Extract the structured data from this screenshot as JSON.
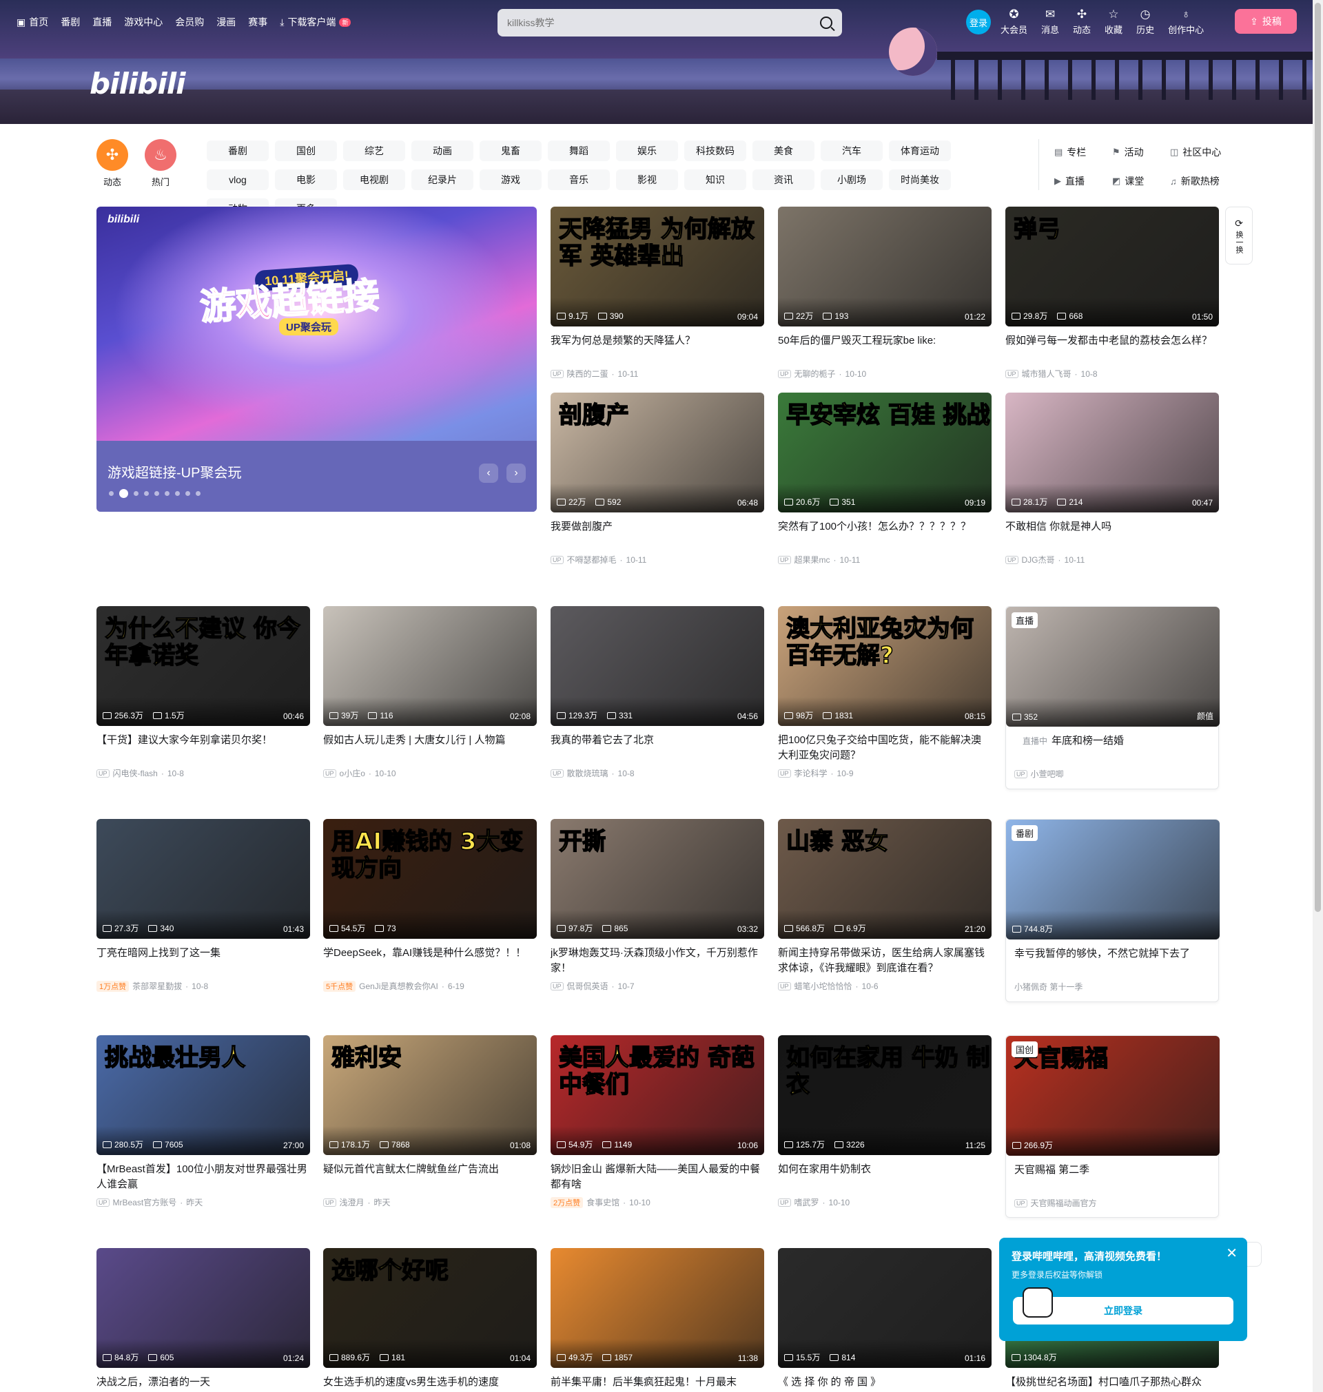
{
  "topnav": {
    "items": [
      "首页",
      "番剧",
      "直播",
      "游戏中心",
      "会员购",
      "漫画",
      "赛事",
      "下载客户端"
    ],
    "new_tag": "新"
  },
  "search": {
    "placeholder": "killkiss教学"
  },
  "header_right": {
    "login": "登录",
    "items": [
      "大会员",
      "消息",
      "动态",
      "收藏",
      "历史",
      "创作中心"
    ],
    "upload": "投稿"
  },
  "brand": {
    "logo_text": "bilibili"
  },
  "channels": {
    "big": [
      {
        "label": "动态",
        "color": "#ff8b27"
      },
      {
        "label": "热门",
        "color": "#f06e6e"
      }
    ],
    "grid": [
      "番剧",
      "国创",
      "综艺",
      "动画",
      "鬼畜",
      "舞蹈",
      "娱乐",
      "科技数码",
      "美食",
      "汽车",
      "体育运动",
      "vlog",
      "电影",
      "电视剧",
      "纪录片",
      "游戏",
      "音乐",
      "影视",
      "知识",
      "资讯",
      "小剧场",
      "时尚美妆",
      "动物",
      "更多"
    ],
    "right": [
      "专栏",
      "活动",
      "社区中心",
      "直播",
      "课堂",
      "新歌热榜"
    ]
  },
  "carousel": {
    "logo": "bilibili",
    "badge": "10.11聚会开启!",
    "headline": "游戏超链接",
    "sub": "UP聚会玩",
    "caption": "游戏超链接-UP聚会玩",
    "active_dot": 1,
    "dot_count": 9
  },
  "refresh": {
    "label": "换一换"
  },
  "colors": {
    "brand_pink": "#fb7299",
    "brand_blue": "#00aeec"
  },
  "videos": [
    {
      "thumb_text": "天降猛男 为何解放军 英雄辈出",
      "views": "9.1万",
      "danmaku": "390",
      "duration": "09:04",
      "title": "我军为何总是频繁的天降猛人？",
      "author": "陕西的二蛋",
      "date": "10-11",
      "bg": "#6b5a3a"
    },
    {
      "thumb_text": "",
      "views": "22万",
      "danmaku": "193",
      "duration": "01:22",
      "title": "50年后的僵尸毁灭工程玩家be like:",
      "author": "无聊的栀子",
      "date": "10-10",
      "bg": "#7d7468"
    },
    {
      "thumb_text": "弹弓",
      "views": "29.8万",
      "danmaku": "668",
      "duration": "01:50",
      "title": "假如弹弓每一发都击中老鼠的荔枝会怎么样？",
      "author": "城市猎人飞哥",
      "date": "10-8",
      "bg": "#2b2a24"
    },
    {
      "thumb_text": "剖腹产",
      "views": "22万",
      "danmaku": "592",
      "duration": "06:48",
      "title": "我要做剖腹产",
      "author": "不嘚瑟都掉毛",
      "date": "10-11",
      "bg": "#c9b7a3"
    },
    {
      "thumb_text": "早安宰炫 百娃 挑战",
      "views": "20.6万",
      "danmaku": "351",
      "duration": "09:19",
      "title": "突然有了100个小孩！怎么办？？？？？？",
      "author": "超果果mc",
      "date": "10-11",
      "bg": "#3a7a3a"
    },
    {
      "thumb_text": "",
      "views": "28.1万",
      "danmaku": "214",
      "duration": "00:47",
      "title": "不敢相信 你就是神人吗",
      "author": "DJG杰哥",
      "date": "10-11",
      "bg": "#d8b6c4"
    },
    {
      "thumb_text": "为什么不建议 你今年拿诺奖",
      "views": "256.3万",
      "danmaku": "1.5万",
      "duration": "00:46",
      "title": "【干货】建议大家今年别拿诺贝尔奖！",
      "author": "闪电侠-flash",
      "date": "10-8",
      "bg": "#2d2d2d"
    },
    {
      "thumb_text": "",
      "views": "39万",
      "danmaku": "116",
      "duration": "02:08",
      "title": "假如古人玩儿走秀 | 大唐女儿行 | 人物篇",
      "author": "o小庄o",
      "date": "10-10",
      "bg": "#c8c2ba"
    },
    {
      "thumb_text": "",
      "views": "129.3万",
      "danmaku": "331",
      "duration": "04:56",
      "title": "我真的带着它去了北京",
      "author": "散散烧琉璃",
      "date": "10-8",
      "bg": "#5c5a5e"
    },
    {
      "thumb_text": "澳大利亚兔灾为何 百年无解?",
      "views": "98万",
      "danmaku": "1831",
      "duration": "08:15",
      "title": "把100亿只兔子交给中国吃货，能不能解决澳大利亚兔灾问题？",
      "author": "李论科学",
      "date": "10-9",
      "bg": "#c9a27a"
    },
    {
      "thumb_text": "",
      "views": "352",
      "danmaku": "",
      "duration": "颜值",
      "title": "年底和榜一结婚",
      "author": "小萱吧唧",
      "date": "",
      "bg": "#bfb6b0",
      "tag": "直播",
      "live": "直播中"
    },
    {
      "thumb_text": "",
      "views": "27.3万",
      "danmaku": "340",
      "duration": "01:43",
      "title": "丁亮在暗网上找到了这一集",
      "author": "茶部翠星勤拔",
      "date": "10-8",
      "hot": "1万点赞",
      "bg": "#3d4a5a"
    },
    {
      "thumb_text": "用AI赚钱的 3大变现方向",
      "views": "54.5万",
      "danmaku": "73",
      "duration": "",
      "title": "学DeepSeek，靠AI赚钱是种什么感觉？！！",
      "author": "GenJi是真想教会你AI",
      "date": "6-19",
      "hot": "5千点赞",
      "bg": "#3a1f10"
    },
    {
      "thumb_text": "开撕",
      "views": "97.8万",
      "danmaku": "865",
      "duration": "03:32",
      "title": "jk罗琳炮轰艾玛·沃森顶级小作文，千万别惹作家！",
      "author": "侃哥侃英语",
      "date": "10-7",
      "bg": "#8a7a6e"
    },
    {
      "thumb_text": "山寨 恶女",
      "views": "566.8万",
      "danmaku": "6.9万",
      "duration": "21:20",
      "title": "新闻主持穿吊带做采访，医生给病人家属塞钱求体谅，《许我耀眼》到底谁在看？",
      "author": "蜡笔小坨恰恰恰",
      "date": "10-6",
      "bg": "#6e5a4a"
    },
    {
      "thumb_text": "",
      "views": "744.8万",
      "danmaku": "",
      "duration": "",
      "title": "幸亏我暂停的够快，不然它就掉下去了",
      "author": "小猪佩奇 第十一季",
      "date": "",
      "bg": "#8fb5e8",
      "tag": "番剧"
    },
    {
      "thumb_text": "挑战最壮男人",
      "views": "280.5万",
      "danmaku": "7605",
      "duration": "27:00",
      "title": "【MrBeast首发】100位小朋友对世界最强壮男人谁会赢",
      "author": "MrBeast官方账号",
      "date": "昨天",
      "bg": "#4a6aa8"
    },
    {
      "thumb_text": "雅利安",
      "views": "178.1万",
      "danmaku": "7868",
      "duration": "01:08",
      "title": "疑似元首代言鱿太仁牌鱿鱼丝广告流出",
      "author": "浅澄月",
      "date": "昨天",
      "bg": "#c9a87a"
    },
    {
      "thumb_text": "美国人最爱的 奇葩中餐们",
      "views": "54.9万",
      "danmaku": "1149",
      "duration": "10:06",
      "title": "锅炒旧金山 酱爆新大陆——美国人最爱的中餐都有啥",
      "author": "食事史馆",
      "date": "10-10",
      "hot": "2万点赞",
      "bg": "#b8282a"
    },
    {
      "thumb_text": "如何在家用 牛奶 制衣",
      "views": "125.7万",
      "danmaku": "3226",
      "duration": "11:25",
      "title": "如何在家用牛奶制衣",
      "author": "嗜武罗",
      "date": "10-10",
      "bg": "#151515"
    },
    {
      "thumb_text": "天官赐福",
      "views": "266.9万",
      "danmaku": "",
      "duration": "",
      "title": "天官赐福 第二季",
      "author": "天官赐福动画官方",
      "date": "",
      "bg": "#b83020",
      "tag": "国创"
    },
    {
      "thumb_text": "",
      "views": "84.8万",
      "danmaku": "605",
      "duration": "01:24",
      "title": "决战之后，漂泊者的一天",
      "author": "",
      "date": "",
      "bg": "#5a4a8a"
    },
    {
      "thumb_text": "选哪个好呢",
      "views": "889.6万",
      "danmaku": "181",
      "duration": "01:04",
      "title": "女生选手机的速度vs男生选手机的速度",
      "author": "",
      "date": "",
      "bg": "#2a2418"
    },
    {
      "thumb_text": "",
      "views": "49.3万",
      "danmaku": "1857",
      "duration": "11:38",
      "title": "前半集平庸！后半集疯狂起鬼！十月最末",
      "author": "",
      "date": "",
      "bg": "#e88a30"
    },
    {
      "thumb_text": "",
      "views": "15.5万",
      "danmaku": "814",
      "duration": "01:16",
      "title": "《 选 择 你 的 帝 国 》",
      "author": "",
      "date": "",
      "bg": "#2a2a2a"
    },
    {
      "thumb_text": "",
      "views": "1304.8万",
      "danmaku": "",
      "duration": "",
      "title": "【极挑世纪名场面】村口嗑爪子那热心群众",
      "author": "",
      "date": "",
      "bg": "#3a8a4a"
    }
  ],
  "login_popup": {
    "title": "登录哔哩哔哩，高清视频免费看！",
    "subtitle": "更多登录后权益等你解锁",
    "button": "立即登录"
  }
}
